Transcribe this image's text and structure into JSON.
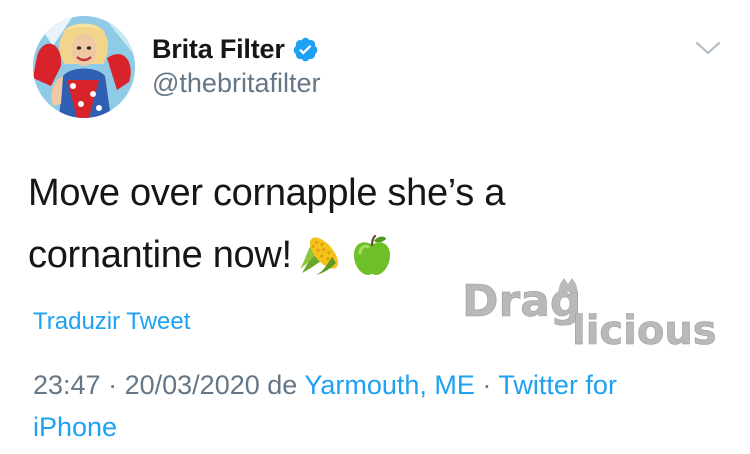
{
  "user": {
    "display_name": "Brita Filter",
    "handle": "@thebritafilter",
    "verified": true
  },
  "tweet": {
    "text_line1": "Move over cornapple she’s a",
    "text_line2": "cornantine now!",
    "emojis": [
      "corn-emoji",
      "green-apple-emoji"
    ]
  },
  "actions": {
    "translate_label": "Traduzir Tweet"
  },
  "meta": {
    "time": "23:47",
    "separator": "·",
    "date": "20/03/2020",
    "preposition": "de",
    "location": "Yarmouth, ME",
    "source_line1": "Twitter for",
    "source_line2": "iPhone"
  },
  "watermark": {
    "text": "Draglicious"
  },
  "colors": {
    "link": "#1da1f2",
    "secondary": "#657786",
    "primary": "#14171a",
    "verified": "#1da1f2"
  }
}
